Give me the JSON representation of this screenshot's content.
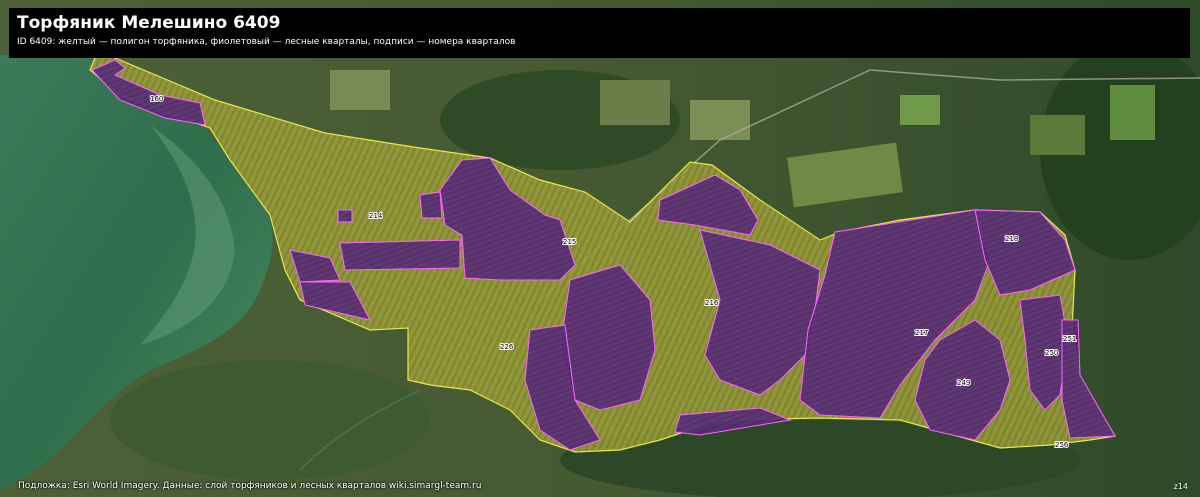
{
  "map": {
    "title": "Торфяник Мелешино 6409",
    "subtitle": "ID 6409: желтый — полигон торфяника, фиолетовый — лесные кварталы, подписи — номера кварталов",
    "attribution": "Подложка: Esri World Imagery. Данные: слой торфяников и лесных кварталов wiki.simargl-team.ru",
    "zoom_label": "z14",
    "colors": {
      "peat_outline": "#e8e84a",
      "peat_fill": "#b8b83a",
      "quarter_outline": "#ff66ff",
      "quarter_fill": "#5a2a78",
      "lake": "#3f7d5a"
    },
    "quarters": [
      {
        "number": "160"
      },
      {
        "number": "214"
      },
      {
        "number": "215"
      },
      {
        "number": "216"
      },
      {
        "number": "217"
      },
      {
        "number": "218"
      },
      {
        "number": "226"
      },
      {
        "number": "249"
      },
      {
        "number": "250"
      },
      {
        "number": "251"
      },
      {
        "number": "256"
      }
    ]
  }
}
